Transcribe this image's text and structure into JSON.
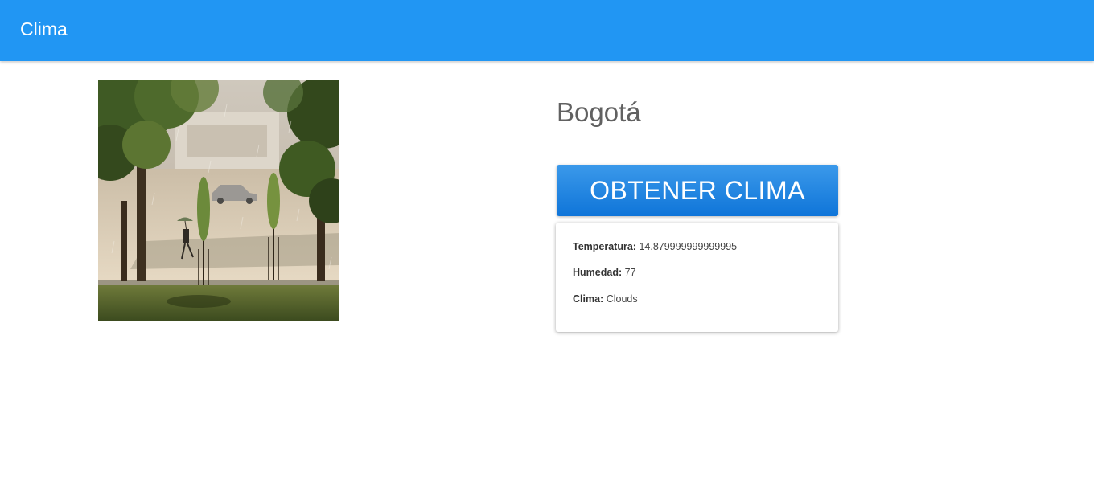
{
  "navbar": {
    "brand": "Clima"
  },
  "photo": {
    "description_icon": "rainy-street-photo"
  },
  "city": {
    "name": "Bogotá"
  },
  "action": {
    "button_label": "OBTENER CLIMA"
  },
  "weather": {
    "temperature_label": "Temperatura:",
    "temperature_value": "14.879999999999995",
    "humidity_label": "Humedad:",
    "humidity_value": "77",
    "condition_label": "Clima:",
    "condition_value": "Clouds"
  },
  "colors": {
    "navbar": "#2196f3",
    "button": "#1e88e5",
    "city_text": "#616161"
  }
}
